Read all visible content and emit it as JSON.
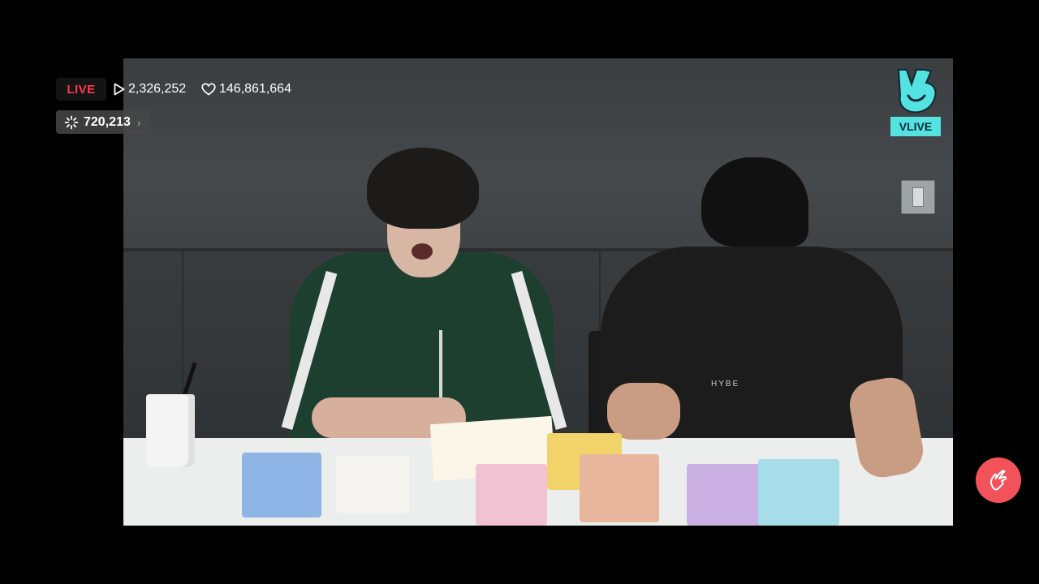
{
  "overlay": {
    "live_label": "LIVE",
    "view_count": "2,326,252",
    "like_count": "146,861,664",
    "chemi_count": "720,213",
    "brand_label": "VLIVE"
  },
  "video": {
    "shirt_logo": "HYBE"
  },
  "colors": {
    "live_red": "#ff3b4d",
    "brand_teal": "#54e3e0",
    "heart_button": "#f2535a"
  },
  "icons": [
    "play-icon",
    "heart-outline-icon",
    "sparkle-icon",
    "chevron-right-icon",
    "vlive-v-icon",
    "finger-heart-icon"
  ]
}
